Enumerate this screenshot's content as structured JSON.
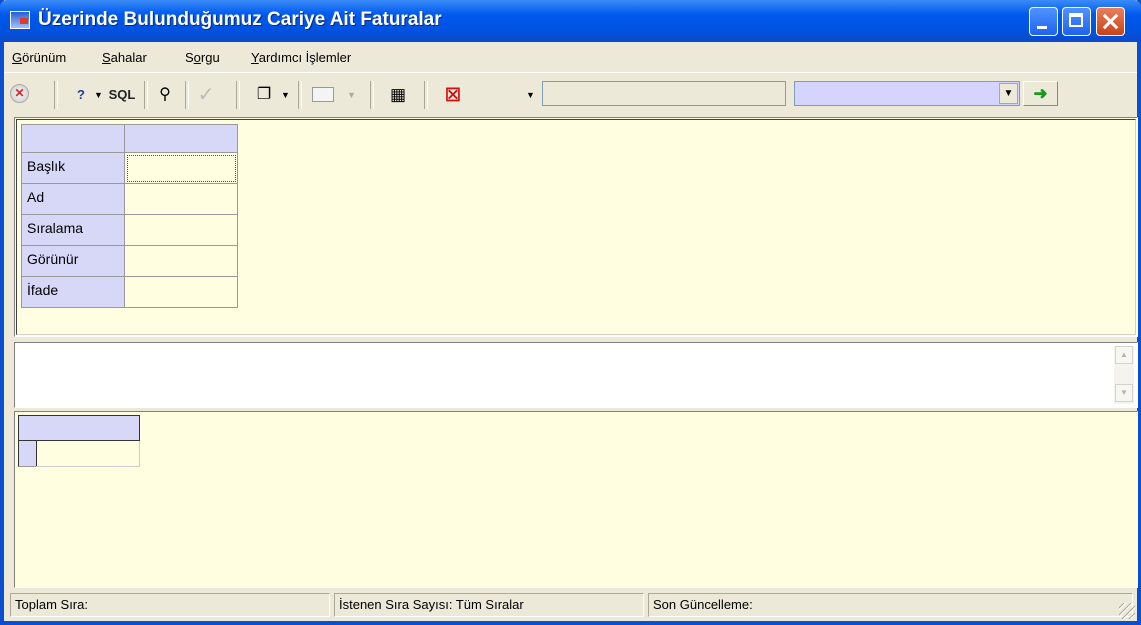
{
  "window": {
    "title": "Üzerinde Bulunduğumuz Cariye Ait Faturalar"
  },
  "menu": {
    "items": [
      {
        "first": "G",
        "rest": "örünüm"
      },
      {
        "first": "S",
        "rest": "ahalar"
      },
      {
        "pre": "S",
        "first": "o",
        "rest": "rgu"
      },
      {
        "first": "Y",
        "rest": "ardımcı İşlemler"
      }
    ]
  },
  "toolbar": {
    "sql_label": "SQL",
    "search_value": "",
    "select_value": "",
    "icons": [
      "cancel-icon",
      "help-icon",
      "sql-icon",
      "binoculars-icon",
      "check-icon",
      "copy-window-icon",
      "frame-icon",
      "grid-icon",
      "delete-grid-icon",
      "go-arrow-icon"
    ]
  },
  "properties_grid": {
    "rows": [
      "Başlık",
      "Ad",
      "Sıralama",
      "Görünür",
      "İfade"
    ],
    "values": [
      "",
      "",
      "",
      "",
      ""
    ]
  },
  "status": {
    "total_rows": "Toplam Sıra:",
    "requested_rows": "İstenen Sıra Sayısı: Tüm Sıralar",
    "last_update": "Son Güncelleme:"
  }
}
